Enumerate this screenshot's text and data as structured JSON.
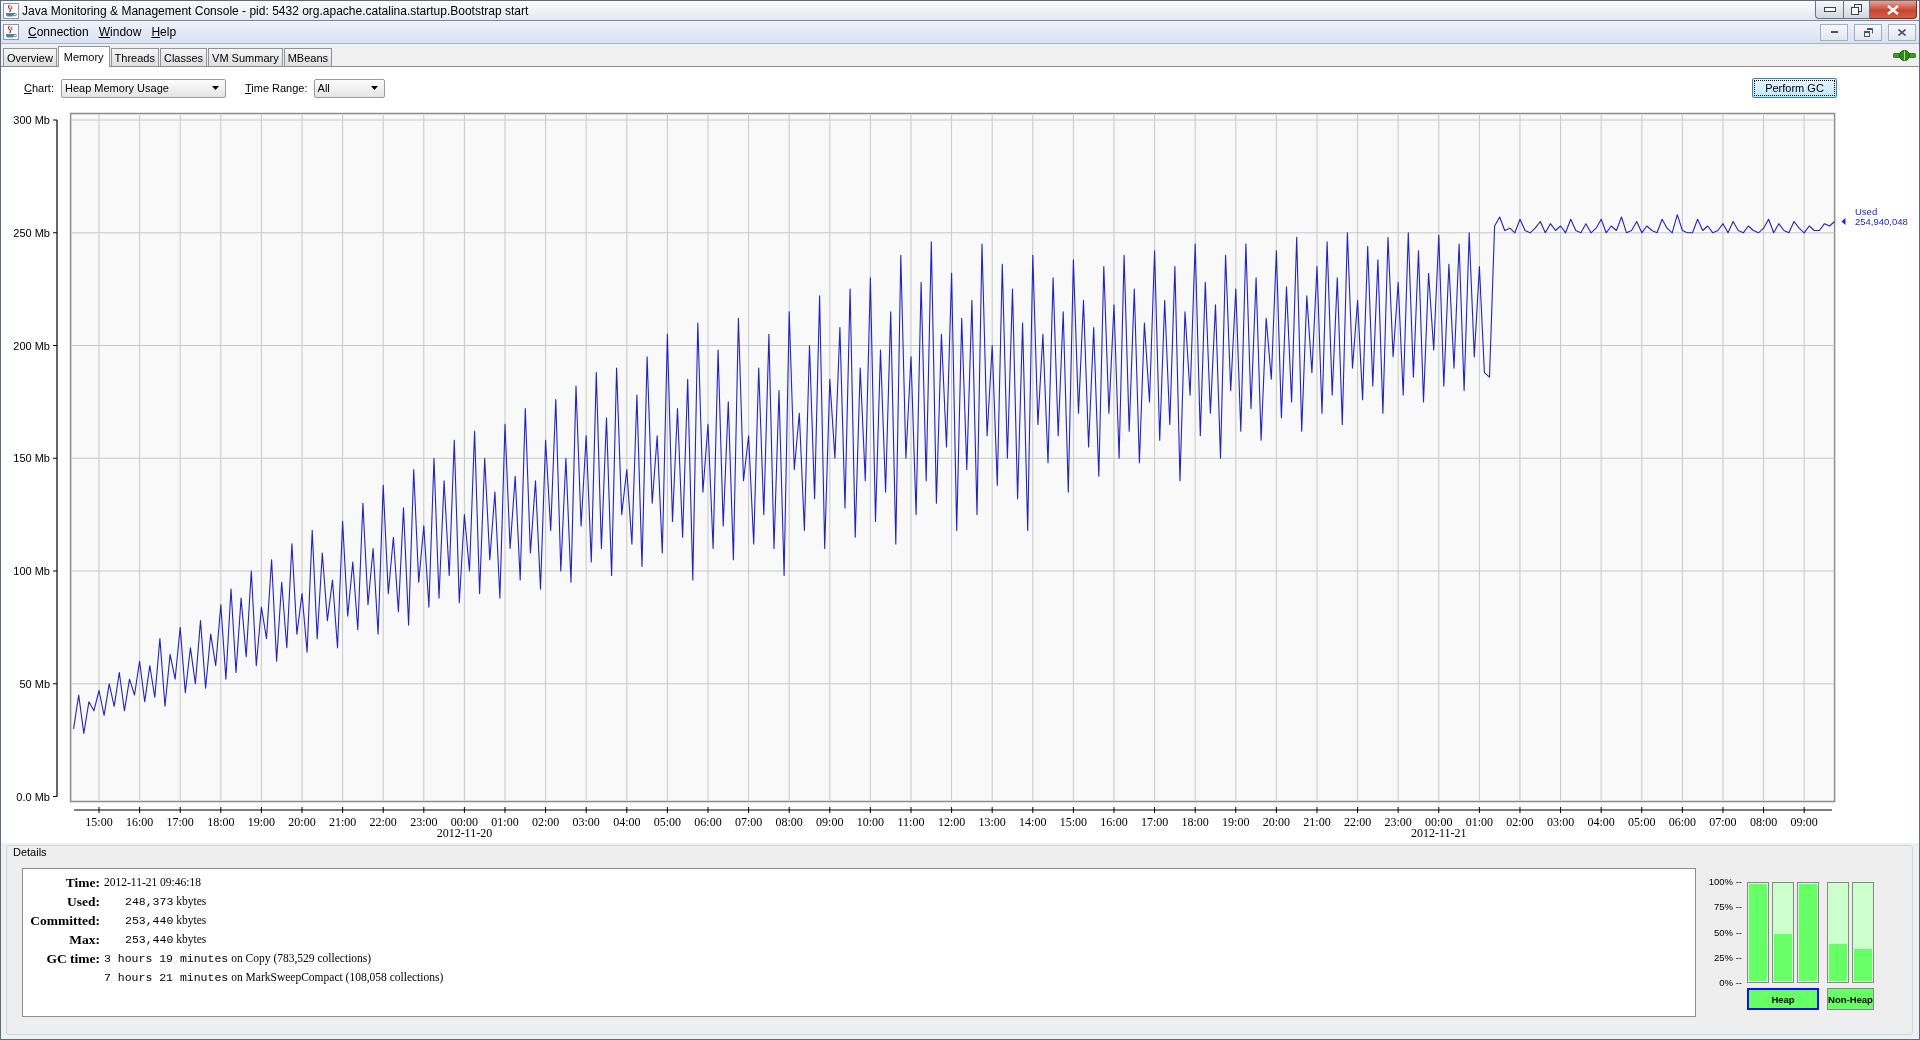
{
  "window": {
    "title": "Java Monitoring & Management Console - pid: 5432 org.apache.catalina.startup.Bootstrap start"
  },
  "menu": [
    {
      "label": "Connection"
    },
    {
      "label": "Window"
    },
    {
      "label": "Help"
    }
  ],
  "tabs": [
    {
      "label": "Overview",
      "selected": false
    },
    {
      "label": "Memory",
      "selected": true
    },
    {
      "label": "Threads",
      "selected": false
    },
    {
      "label": "Classes",
      "selected": false
    },
    {
      "label": "VM Summary",
      "selected": false
    },
    {
      "label": "MBeans",
      "selected": false
    }
  ],
  "chart_selector": {
    "label": "Chart:",
    "value": "Heap Memory Usage"
  },
  "time_range_selector": {
    "label": "Time Range:",
    "value": "All"
  },
  "perform_gc_button": {
    "label": "Perform GC",
    "focused": true
  },
  "memory_chart": {
    "chart_data": {
      "type": "line",
      "grid": true,
      "xlim": [
        "2012-11-19 14:18:00",
        "2012-11-21 09:45:00"
      ],
      "ylim": [
        0,
        300
      ],
      "xticks": [
        {
          "value": "2012-11-19 15:00:00",
          "label": "15:00"
        },
        {
          "value": "2012-11-19 16:00:00",
          "label": "16:00"
        },
        {
          "value": "2012-11-19 17:00:00",
          "label": "17:00"
        },
        {
          "value": "2012-11-19 18:00:00",
          "label": "18:00"
        },
        {
          "value": "2012-11-19 19:00:00",
          "label": "19:00"
        },
        {
          "value": "2012-11-19 20:00:00",
          "label": "20:00"
        },
        {
          "value": "2012-11-19 21:00:00",
          "label": "21:00"
        },
        {
          "value": "2012-11-19 22:00:00",
          "label": "22:00"
        },
        {
          "value": "2012-11-19 23:00:00",
          "label": "23:00"
        },
        {
          "value": "2012-11-20 00:00:00",
          "label": "00:00"
        },
        {
          "value": "2012-11-20 01:00:00",
          "label": "01:00"
        },
        {
          "value": "2012-11-20 02:00:00",
          "label": "02:00"
        },
        {
          "value": "2012-11-20 03:00:00",
          "label": "03:00"
        },
        {
          "value": "2012-11-20 04:00:00",
          "label": "04:00"
        },
        {
          "value": "2012-11-20 05:00:00",
          "label": "05:00"
        },
        {
          "value": "2012-11-20 06:00:00",
          "label": "06:00"
        },
        {
          "value": "2012-11-20 07:00:00",
          "label": "07:00"
        },
        {
          "value": "2012-11-20 08:00:00",
          "label": "08:00"
        },
        {
          "value": "2012-11-20 09:00:00",
          "label": "09:00"
        },
        {
          "value": "2012-11-20 10:00:00",
          "label": "10:00"
        },
        {
          "value": "2012-11-20 11:00:00",
          "label": "11:00"
        },
        {
          "value": "2012-11-20 12:00:00",
          "label": "12:00"
        },
        {
          "value": "2012-11-20 13:00:00",
          "label": "13:00"
        },
        {
          "value": "2012-11-20 14:00:00",
          "label": "14:00"
        },
        {
          "value": "2012-11-20 15:00:00",
          "label": "15:00"
        },
        {
          "value": "2012-11-20 16:00:00",
          "label": "16:00"
        },
        {
          "value": "2012-11-20 17:00:00",
          "label": "17:00"
        },
        {
          "value": "2012-11-20 18:00:00",
          "label": "18:00"
        },
        {
          "value": "2012-11-20 19:00:00",
          "label": "19:00"
        },
        {
          "value": "2012-11-20 20:00:00",
          "label": "20:00"
        },
        {
          "value": "2012-11-20 21:00:00",
          "label": "21:00"
        },
        {
          "value": "2012-11-20 22:00:00",
          "label": "22:00"
        },
        {
          "value": "2012-11-20 23:00:00",
          "label": "23:00"
        },
        {
          "value": "2012-11-21 00:00:00",
          "label": "00:00"
        },
        {
          "value": "2012-11-21 01:00:00",
          "label": "01:00"
        },
        {
          "value": "2012-11-21 02:00:00",
          "label": "02:00"
        },
        {
          "value": "2012-11-21 03:00:00",
          "label": "03:00"
        },
        {
          "value": "2012-11-21 04:00:00",
          "label": "04:00"
        },
        {
          "value": "2012-11-21 05:00:00",
          "label": "05:00"
        },
        {
          "value": "2012-11-21 06:00:00",
          "label": "06:00"
        },
        {
          "value": "2012-11-21 07:00:00",
          "label": "07:00"
        },
        {
          "value": "2012-11-21 08:00:00",
          "label": "08:00"
        },
        {
          "value": "2012-11-21 09:00:00",
          "label": "09:00"
        }
      ],
      "yticks": [
        {
          "value": 0,
          "label": "0.0 Mb"
        },
        {
          "value": 50,
          "label": "50 Mb"
        },
        {
          "value": 100,
          "label": "100 Mb"
        },
        {
          "value": 150,
          "label": "150 Mb"
        },
        {
          "value": 200,
          "label": "200 Mb"
        },
        {
          "value": 250,
          "label": "250 Mb"
        },
        {
          "value": 300,
          "label": "300 Mb"
        }
      ],
      "annotations": [
        "2012-11-20",
        "2012-11-21"
      ],
      "x": [
        "2012-11-19 14:22:30",
        "2012-11-19 14:30:00",
        "2012-11-19 14:37:30",
        "2012-11-19 14:45:00",
        "2012-11-19 14:52:30",
        "2012-11-19 15:00:00",
        "2012-11-19 15:07:30",
        "2012-11-19 15:15:00",
        "2012-11-19 15:22:30",
        "2012-11-19 15:30:00",
        "2012-11-19 15:37:30",
        "2012-11-19 15:45:00",
        "2012-11-19 15:52:30",
        "2012-11-19 16:00:00",
        "2012-11-19 16:07:30",
        "2012-11-19 16:15:00",
        "2012-11-19 16:22:30",
        "2012-11-19 16:30:00",
        "2012-11-19 16:37:30",
        "2012-11-19 16:45:00",
        "2012-11-19 16:52:30",
        "2012-11-19 17:00:00",
        "2012-11-19 17:07:30",
        "2012-11-19 17:15:00",
        "2012-11-19 17:22:30",
        "2012-11-19 17:30:00",
        "2012-11-19 17:37:30",
        "2012-11-19 17:45:00",
        "2012-11-19 17:52:30",
        "2012-11-19 18:00:00",
        "2012-11-19 18:07:30",
        "2012-11-19 18:15:00",
        "2012-11-19 18:22:30",
        "2012-11-19 18:30:00",
        "2012-11-19 18:37:30",
        "2012-11-19 18:45:00",
        "2012-11-19 18:52:30",
        "2012-11-19 19:00:00",
        "2012-11-19 19:07:30",
        "2012-11-19 19:15:00",
        "2012-11-19 19:22:30",
        "2012-11-19 19:30:00",
        "2012-11-19 19:37:30",
        "2012-11-19 19:45:00",
        "2012-11-19 19:52:30",
        "2012-11-19 20:00:00",
        "2012-11-19 20:07:30",
        "2012-11-19 20:15:00",
        "2012-11-19 20:22:30",
        "2012-11-19 20:30:00",
        "2012-11-19 20:37:30",
        "2012-11-19 20:45:00",
        "2012-11-19 20:52:30",
        "2012-11-19 21:00:00",
        "2012-11-19 21:07:30",
        "2012-11-19 21:15:00",
        "2012-11-19 21:22:30",
        "2012-11-19 21:30:00",
        "2012-11-19 21:37:30",
        "2012-11-19 21:45:00",
        "2012-11-19 21:52:30",
        "2012-11-19 22:00:00",
        "2012-11-19 22:07:30",
        "2012-11-19 22:15:00",
        "2012-11-19 22:22:30",
        "2012-11-19 22:30:00",
        "2012-11-19 22:37:30",
        "2012-11-19 22:45:00",
        "2012-11-19 22:52:30",
        "2012-11-19 23:00:00",
        "2012-11-19 23:07:30",
        "2012-11-19 23:15:00",
        "2012-11-19 23:22:30",
        "2012-11-19 23:30:00",
        "2012-11-19 23:37:30",
        "2012-11-19 23:45:00",
        "2012-11-19 23:52:30",
        "2012-11-20 00:00:00",
        "2012-11-20 00:07:30",
        "2012-11-20 00:15:00",
        "2012-11-20 00:22:30",
        "2012-11-20 00:30:00",
        "2012-11-20 00:37:30",
        "2012-11-20 00:45:00",
        "2012-11-20 00:52:30",
        "2012-11-20 01:00:00",
        "2012-11-20 01:07:30",
        "2012-11-20 01:15:00",
        "2012-11-20 01:22:30",
        "2012-11-20 01:30:00",
        "2012-11-20 01:37:30",
        "2012-11-20 01:45:00",
        "2012-11-20 01:52:30",
        "2012-11-20 02:00:00",
        "2012-11-20 02:07:30",
        "2012-11-20 02:15:00",
        "2012-11-20 02:22:30",
        "2012-11-20 02:30:00",
        "2012-11-20 02:37:30",
        "2012-11-20 02:45:00",
        "2012-11-20 02:52:30",
        "2012-11-20 03:00:00",
        "2012-11-20 03:07:30",
        "2012-11-20 03:15:00",
        "2012-11-20 03:22:30",
        "2012-11-20 03:30:00",
        "2012-11-20 03:37:30",
        "2012-11-20 03:45:00",
        "2012-11-20 03:52:30",
        "2012-11-20 04:00:00",
        "2012-11-20 04:07:30",
        "2012-11-20 04:15:00",
        "2012-11-20 04:22:30",
        "2012-11-20 04:30:00",
        "2012-11-20 04:37:30",
        "2012-11-20 04:45:00",
        "2012-11-20 04:52:30",
        "2012-11-20 05:00:00",
        "2012-11-20 05:07:30",
        "2012-11-20 05:15:00",
        "2012-11-20 05:22:30",
        "2012-11-20 05:30:00",
        "2012-11-20 05:37:30",
        "2012-11-20 05:45:00",
        "2012-11-20 05:52:30",
        "2012-11-20 06:00:00",
        "2012-11-20 06:07:30",
        "2012-11-20 06:15:00",
        "2012-11-20 06:22:30",
        "2012-11-20 06:30:00",
        "2012-11-20 06:37:30",
        "2012-11-20 06:45:00",
        "2012-11-20 06:52:30",
        "2012-11-20 07:00:00",
        "2012-11-20 07:07:30",
        "2012-11-20 07:15:00",
        "2012-11-20 07:22:30",
        "2012-11-20 07:30:00",
        "2012-11-20 07:37:30",
        "2012-11-20 07:45:00",
        "2012-11-20 07:52:30",
        "2012-11-20 08:00:00",
        "2012-11-20 08:07:30",
        "2012-11-20 08:15:00",
        "2012-11-20 08:22:30",
        "2012-11-20 08:30:00",
        "2012-11-20 08:37:30",
        "2012-11-20 08:45:00",
        "2012-11-20 08:52:30",
        "2012-11-20 09:00:00",
        "2012-11-20 09:07:30",
        "2012-11-20 09:15:00",
        "2012-11-20 09:22:30",
        "2012-11-20 09:30:00",
        "2012-11-20 09:37:30",
        "2012-11-20 09:45:00",
        "2012-11-20 09:52:30",
        "2012-11-20 10:00:00",
        "2012-11-20 10:07:30",
        "2012-11-20 10:15:00",
        "2012-11-20 10:22:30",
        "2012-11-20 10:30:00",
        "2012-11-20 10:37:30",
        "2012-11-20 10:45:00",
        "2012-11-20 10:52:30",
        "2012-11-20 11:00:00",
        "2012-11-20 11:07:30",
        "2012-11-20 11:15:00",
        "2012-11-20 11:22:30",
        "2012-11-20 11:30:00",
        "2012-11-20 11:37:30",
        "2012-11-20 11:45:00",
        "2012-11-20 11:52:30",
        "2012-11-20 12:00:00",
        "2012-11-20 12:07:30",
        "2012-11-20 12:15:00",
        "2012-11-20 12:22:30",
        "2012-11-20 12:30:00",
        "2012-11-20 12:37:30",
        "2012-11-20 12:45:00",
        "2012-11-20 12:52:30",
        "2012-11-20 13:00:00",
        "2012-11-20 13:07:30",
        "2012-11-20 13:15:00",
        "2012-11-20 13:22:30",
        "2012-11-20 13:30:00",
        "2012-11-20 13:37:30",
        "2012-11-20 13:45:00",
        "2012-11-20 13:52:30",
        "2012-11-20 14:00:00",
        "2012-11-20 14:07:30",
        "2012-11-20 14:15:00",
        "2012-11-20 14:22:30",
        "2012-11-20 14:30:00",
        "2012-11-20 14:37:30",
        "2012-11-20 14:45:00",
        "2012-11-20 14:52:30",
        "2012-11-20 15:00:00",
        "2012-11-20 15:07:30",
        "2012-11-20 15:15:00",
        "2012-11-20 15:22:30",
        "2012-11-20 15:30:00",
        "2012-11-20 15:37:30",
        "2012-11-20 15:45:00",
        "2012-11-20 15:52:30",
        "2012-11-20 16:00:00",
        "2012-11-20 16:07:30",
        "2012-11-20 16:15:00",
        "2012-11-20 16:22:30",
        "2012-11-20 16:30:00",
        "2012-11-20 16:37:30",
        "2012-11-20 16:45:00",
        "2012-11-20 16:52:30",
        "2012-11-20 17:00:00",
        "2012-11-20 17:07:30",
        "2012-11-20 17:15:00",
        "2012-11-20 17:22:30",
        "2012-11-20 17:30:00",
        "2012-11-20 17:37:30",
        "2012-11-20 17:45:00",
        "2012-11-20 17:52:30",
        "2012-11-20 18:00:00",
        "2012-11-20 18:07:30",
        "2012-11-20 18:15:00",
        "2012-11-20 18:22:30",
        "2012-11-20 18:30:00",
        "2012-11-20 18:37:30",
        "2012-11-20 18:45:00",
        "2012-11-20 18:52:30",
        "2012-11-20 19:00:00",
        "2012-11-20 19:07:30",
        "2012-11-20 19:15:00",
        "2012-11-20 19:22:30",
        "2012-11-20 19:30:00",
        "2012-11-20 19:37:30",
        "2012-11-20 19:45:00",
        "2012-11-20 19:52:30",
        "2012-11-20 20:00:00",
        "2012-11-20 20:07:30",
        "2012-11-20 20:15:00",
        "2012-11-20 20:22:30",
        "2012-11-20 20:30:00",
        "2012-11-20 20:37:30",
        "2012-11-20 20:45:00",
        "2012-11-20 20:52:30",
        "2012-11-20 21:00:00",
        "2012-11-20 21:07:30",
        "2012-11-20 21:15:00",
        "2012-11-20 21:22:30",
        "2012-11-20 21:30:00",
        "2012-11-20 21:37:30",
        "2012-11-20 21:45:00",
        "2012-11-20 21:52:30",
        "2012-11-20 22:00:00",
        "2012-11-20 22:07:30",
        "2012-11-20 22:15:00",
        "2012-11-20 22:22:30",
        "2012-11-20 22:30:00",
        "2012-11-20 22:37:30",
        "2012-11-20 22:45:00",
        "2012-11-20 22:52:30",
        "2012-11-20 23:00:00",
        "2012-11-20 23:07:30",
        "2012-11-20 23:15:00",
        "2012-11-20 23:22:30",
        "2012-11-20 23:30:00",
        "2012-11-20 23:37:30",
        "2012-11-20 23:45:00",
        "2012-11-20 23:52:30",
        "2012-11-21 00:00:00",
        "2012-11-21 00:07:30",
        "2012-11-21 00:15:00",
        "2012-11-21 00:22:30",
        "2012-11-21 00:30:00",
        "2012-11-21 00:37:30",
        "2012-11-21 00:45:00",
        "2012-11-21 00:52:30",
        "2012-11-21 01:00:00",
        "2012-11-21 01:07:30",
        "2012-11-21 01:15:00",
        "2012-11-21 01:22:30",
        "2012-11-21 01:30:00",
        "2012-11-21 01:37:30",
        "2012-11-21 01:45:00",
        "2012-11-21 01:52:30",
        "2012-11-21 02:00:00",
        "2012-11-21 02:07:30",
        "2012-11-21 02:15:00",
        "2012-11-21 02:22:30",
        "2012-11-21 02:30:00",
        "2012-11-21 02:37:30",
        "2012-11-21 02:45:00",
        "2012-11-21 02:52:30",
        "2012-11-21 03:00:00",
        "2012-11-21 03:07:30",
        "2012-11-21 03:15:00",
        "2012-11-21 03:22:30",
        "2012-11-21 03:30:00",
        "2012-11-21 03:37:30",
        "2012-11-21 03:45:00",
        "2012-11-21 03:52:30",
        "2012-11-21 04:00:00",
        "2012-11-21 04:07:30",
        "2012-11-21 04:15:00",
        "2012-11-21 04:22:30",
        "2012-11-21 04:30:00",
        "2012-11-21 04:37:30",
        "2012-11-21 04:45:00",
        "2012-11-21 04:52:30",
        "2012-11-21 05:00:00",
        "2012-11-21 05:07:30",
        "2012-11-21 05:15:00",
        "2012-11-21 05:22:30",
        "2012-11-21 05:30:00",
        "2012-11-21 05:37:30",
        "2012-11-21 05:45:00",
        "2012-11-21 05:52:30",
        "2012-11-21 06:00:00",
        "2012-11-21 06:07:30",
        "2012-11-21 06:15:00",
        "2012-11-21 06:22:30",
        "2012-11-21 06:30:00",
        "2012-11-21 06:37:30",
        "2012-11-21 06:45:00",
        "2012-11-21 06:52:30",
        "2012-11-21 07:00:00",
        "2012-11-21 07:07:30",
        "2012-11-21 07:15:00",
        "2012-11-21 07:22:30",
        "2012-11-21 07:30:00",
        "2012-11-21 07:37:30",
        "2012-11-21 07:45:00",
        "2012-11-21 07:52:30",
        "2012-11-21 08:00:00",
        "2012-11-21 08:07:30",
        "2012-11-21 08:15:00",
        "2012-11-21 08:22:30",
        "2012-11-21 08:30:00",
        "2012-11-21 08:37:30",
        "2012-11-21 08:45:00",
        "2012-11-21 08:52:30",
        "2012-11-21 09:00:00",
        "2012-11-21 09:07:30",
        "2012-11-21 09:15:00",
        "2012-11-21 09:22:30",
        "2012-11-21 09:30:00",
        "2012-11-21 09:37:30",
        "2012-11-21 09:45:00"
      ],
      "series": [
        {
          "name": "Used",
          "color": "#2323c0",
          "values": [
            30,
            45,
            28,
            42,
            38,
            47,
            36,
            50,
            40,
            55,
            38,
            52,
            45,
            60,
            42,
            58,
            44,
            70,
            40,
            63,
            52,
            75,
            46,
            66,
            50,
            78,
            48,
            72,
            58,
            85,
            52,
            92,
            55,
            88,
            62,
            100,
            58,
            84,
            70,
            105,
            60,
            95,
            66,
            112,
            72,
            90,
            64,
            118,
            70,
            108,
            78,
            96,
            66,
            122,
            80,
            104,
            74,
            130,
            85,
            110,
            72,
            138,
            90,
            115,
            82,
            128,
            76,
            145,
            95,
            120,
            84,
            150,
            88,
            140,
            98,
            158,
            86,
            125,
            100,
            162,
            90,
            150,
            105,
            135,
            88,
            165,
            110,
            142,
            96,
            172,
            108,
            140,
            92,
            158,
            118,
            176,
            100,
            150,
            95,
            182,
            120,
            160,
            104,
            188,
            110,
            168,
            98,
            190,
            125,
            145,
            112,
            178,
            102,
            195,
            130,
            160,
            108,
            205,
            122,
            172,
            115,
            185,
            96,
            210,
            135,
            165,
            110,
            198,
            120,
            175,
            105,
            212,
            140,
            160,
            112,
            190,
            125,
            205,
            110,
            180,
            98,
            215,
            145,
            170,
            118,
            200,
            132,
            222,
            110,
            185,
            150,
            208,
            128,
            225,
            115,
            190,
            140,
            230,
            122,
            198,
            135,
            215,
            112,
            240,
            150,
            195,
            125,
            228,
            140,
            246,
            130,
            205,
            155,
            232,
            118,
            212,
            145,
            220,
            125,
            245,
            160,
            200,
            138,
            236,
            150,
            225,
            132,
            210,
            118,
            240,
            165,
            205,
            148,
            230,
            160,
            215,
            135,
            238,
            170,
            220,
            155,
            208,
            142,
            235,
            170,
            218,
            150,
            240,
            162,
            225,
            148,
            210,
            175,
            242,
            158,
            220,
            165,
            235,
            140,
            215,
            178,
            245,
            160,
            228,
            170,
            218,
            150,
            240,
            180,
            225,
            162,
            245,
            172,
            230,
            158,
            212,
            185,
            242,
            168,
            226,
            175,
            248,
            162,
            222,
            188,
            235,
            170,
            246,
            178,
            230,
            165,
            250,
            190,
            220,
            176,
            244,
            182,
            238,
            170,
            248,
            195,
            228,
            178,
            250,
            186,
            242,
            175,
            232,
            198,
            249,
            182,
            236,
            190,
            245,
            180,
            250,
            195,
            235,
            188,
            186,
            253,
            257,
            251,
            252,
            250,
            256,
            251,
            250,
            252,
            255,
            250,
            254,
            251,
            253,
            250,
            256,
            251,
            250,
            254,
            250,
            252,
            256,
            250,
            253,
            251,
            257,
            250,
            251,
            255,
            250,
            253,
            251,
            250,
            256,
            252,
            250,
            258,
            251,
            250,
            250,
            256,
            251,
            253,
            250,
            251,
            254,
            250,
            255,
            251,
            250,
            253,
            251,
            250,
            252,
            256,
            250,
            254,
            251,
            250,
            255,
            252,
            250,
            253,
            251,
            251,
            254,
            253,
            255
          ]
        }
      ]
    },
    "current_value": "254,940,048"
  },
  "details": {
    "title": "Details",
    "rows": [
      {
        "kind": "text",
        "label": "Time:",
        "value": "2012-11-21 09:46:18"
      },
      {
        "kind": "quantity",
        "label": "Used:",
        "number": "248,373",
        "unit": "kbytes"
      },
      {
        "kind": "quantity",
        "label": "Committed:",
        "number": "253,440",
        "unit": "kbytes"
      },
      {
        "kind": "quantity",
        "label": "Max:",
        "number": "253,440",
        "unit": "kbytes"
      },
      {
        "kind": "gc",
        "label": "GC time:",
        "entries": [
          {
            "duration": "3 hours 19 minutes",
            "text": "on Copy (783,529 collections)"
          },
          {
            "duration": "7 hours 21 minutes",
            "text": "on MarkSweepCompact (108,058 collections)"
          }
        ]
      }
    ]
  },
  "memory_pools": {
    "scale": [
      "100% --",
      "75% --",
      "50% --",
      "25% --",
      "0% --"
    ],
    "groups": [
      {
        "label": "Heap",
        "selected": true,
        "bars": [
          {
            "level": 1.0
          },
          {
            "level": 0.48
          },
          {
            "level": 1.0
          }
        ]
      },
      {
        "label": "Non-Heap",
        "selected": false,
        "bars": [
          {
            "level": 0.38
          },
          {
            "level": 0.33
          }
        ]
      }
    ]
  }
}
